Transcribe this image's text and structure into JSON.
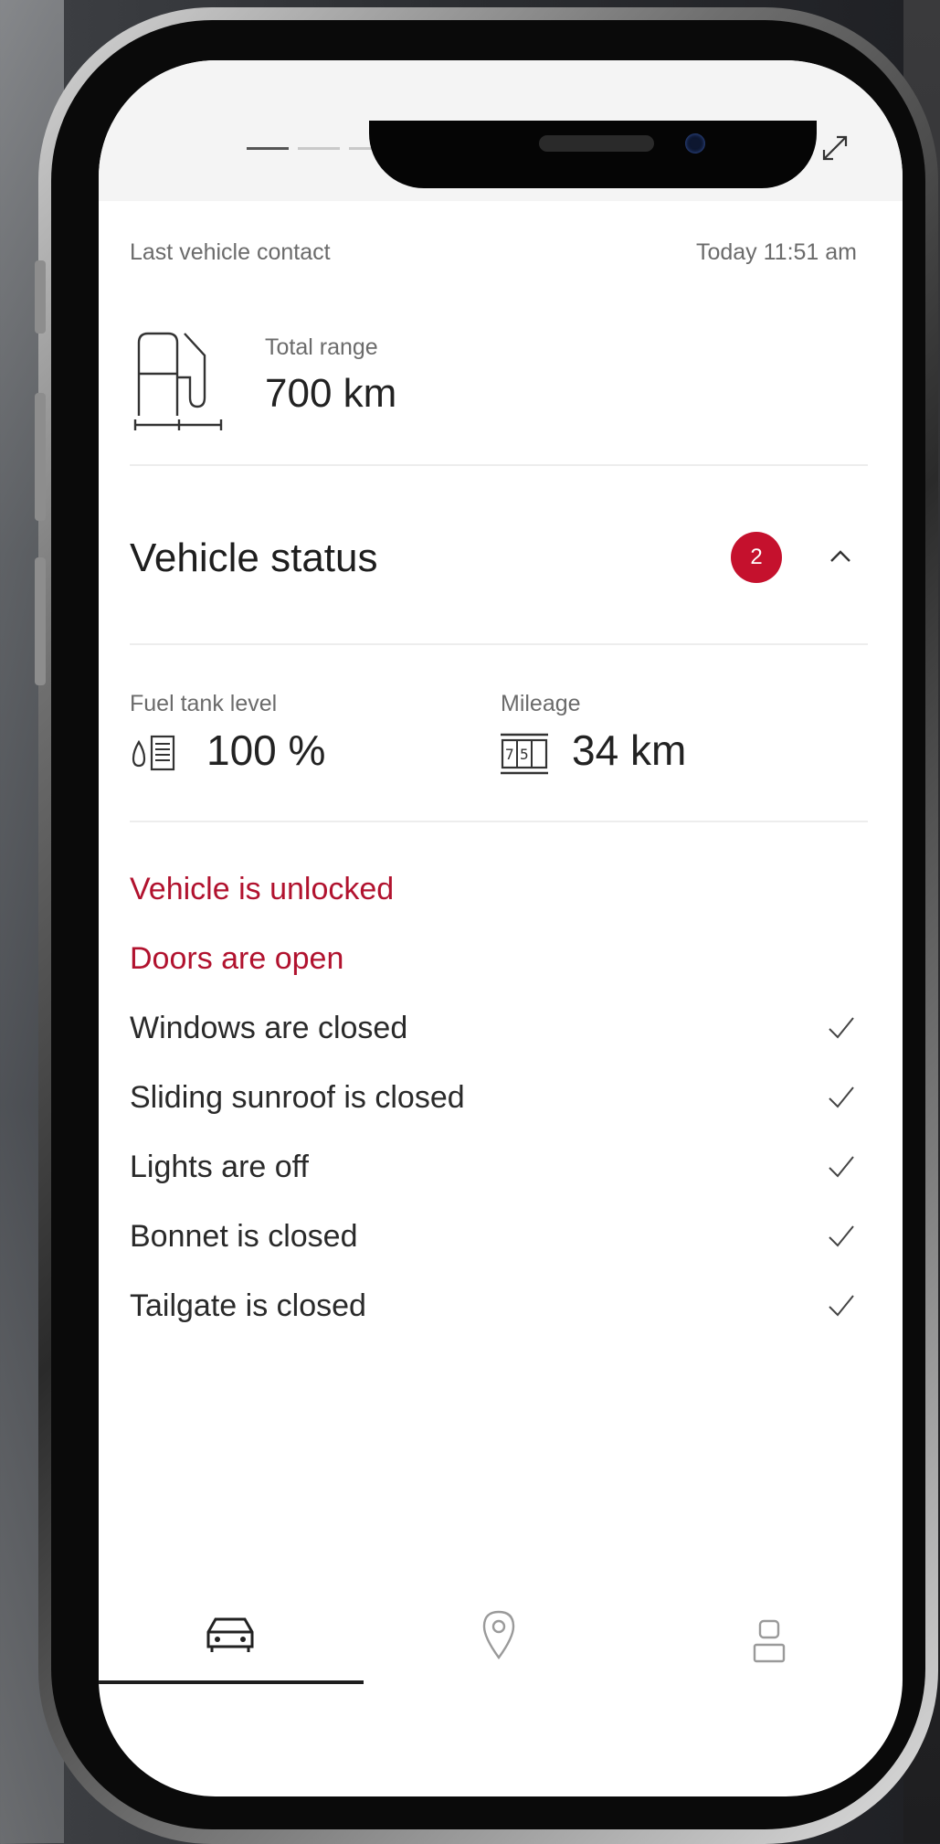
{
  "header": {
    "page_count": 10,
    "active_page": 1,
    "expand_icon": "expand-icon"
  },
  "contact": {
    "label": "Last vehicle contact",
    "time": "Today 11:51 am"
  },
  "range": {
    "label": "Total range",
    "value": "700 km",
    "icon": "fuel-pump-range-icon"
  },
  "vehicle_status": {
    "title": "Vehicle status",
    "badge_count": "2",
    "collapse_icon": "chevron-up-icon",
    "accent_color": "#c5112d"
  },
  "metrics": {
    "fuel_label": "Fuel tank level",
    "fuel_value": "100 %",
    "mileage_label": "Mileage",
    "mileage_value": "34 km"
  },
  "alerts": [
    "Vehicle is unlocked",
    "Doors are open"
  ],
  "checks": [
    "Windows are closed",
    "Sliding sunroof is closed",
    "Lights are off",
    "Bonnet is closed",
    "Tailgate is closed"
  ],
  "bottom_nav": {
    "items": [
      "car-icon",
      "location-pin-icon",
      "profile-icon"
    ],
    "active": "car-icon"
  }
}
